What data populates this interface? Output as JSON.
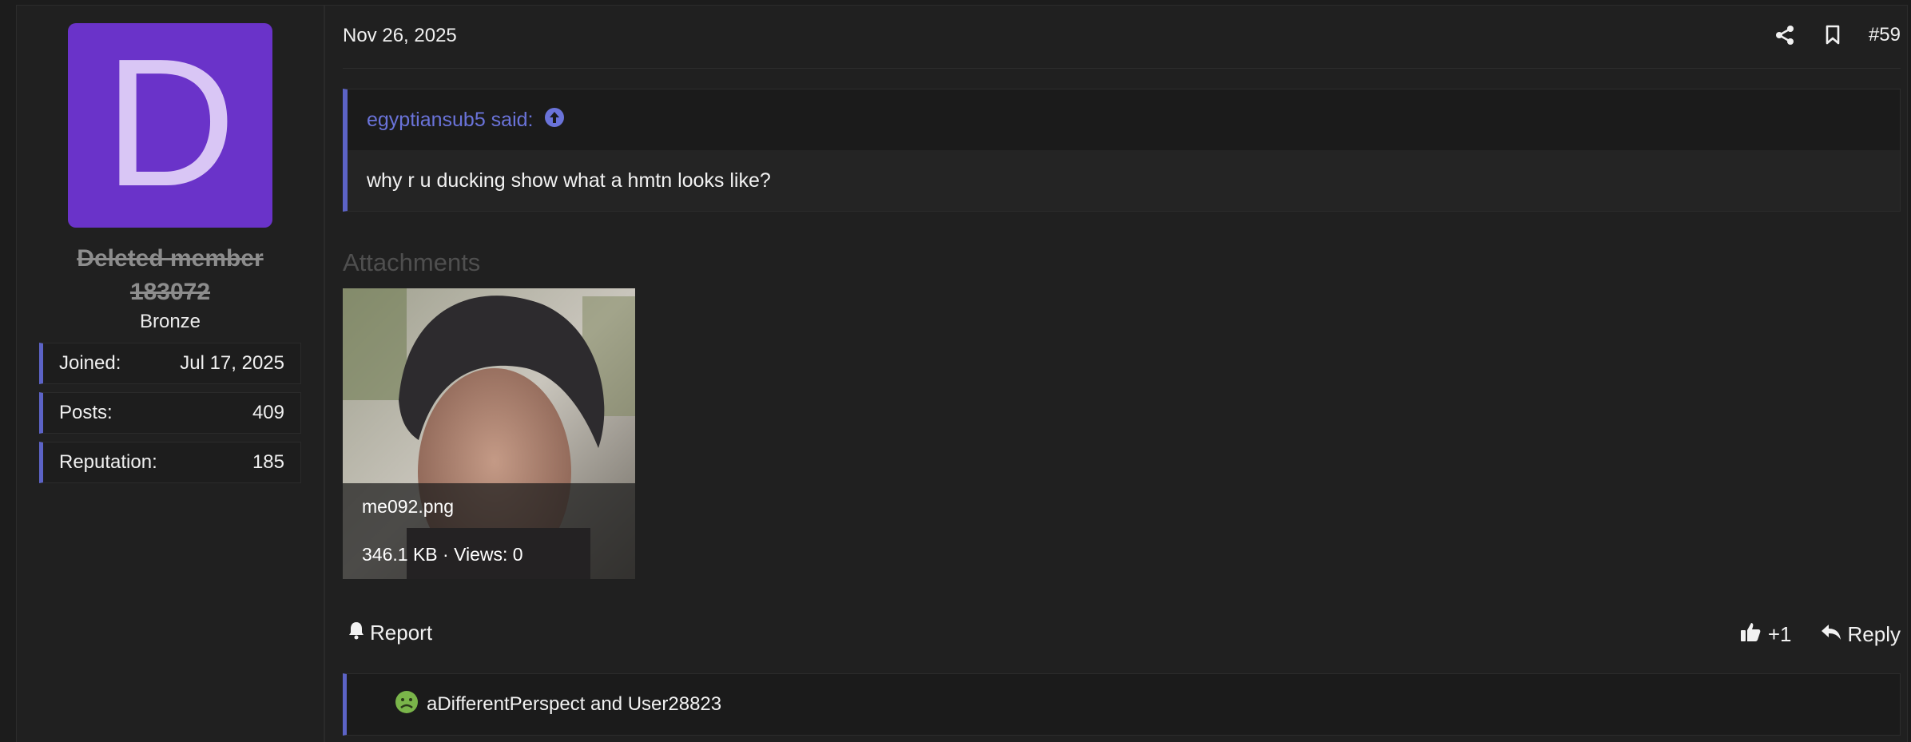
{
  "user": {
    "avatar_letter": "D",
    "avatar_color": "#6a33c9",
    "name_line1": "Deleted member",
    "name_line2": "183072",
    "rank": "Bronze",
    "stats": [
      {
        "label": "Joined:",
        "value": "Jul 17, 2025"
      },
      {
        "label": "Posts:",
        "value": "409"
      },
      {
        "label": "Reputation:",
        "value": "185"
      }
    ]
  },
  "post": {
    "date": "Nov 26, 2025",
    "number": "#59",
    "share_icon": "share-icon",
    "bookmark_icon": "bookmark-icon"
  },
  "quote": {
    "author_said": "egyptiansub5 said:",
    "text": "why r u ducking show what a hmtn looks like?",
    "accent_color": "#5c63c6"
  },
  "attachments": {
    "title": "Attachments",
    "items": [
      {
        "filename": "me092.png",
        "meta": "346.1 KB · Views: 0"
      }
    ]
  },
  "footer": {
    "report_label": "Report",
    "like_label": "+1",
    "reply_label": "Reply"
  },
  "reactions": {
    "text": "aDifferentPerspect and User28823",
    "icon": "sick-face-icon"
  }
}
